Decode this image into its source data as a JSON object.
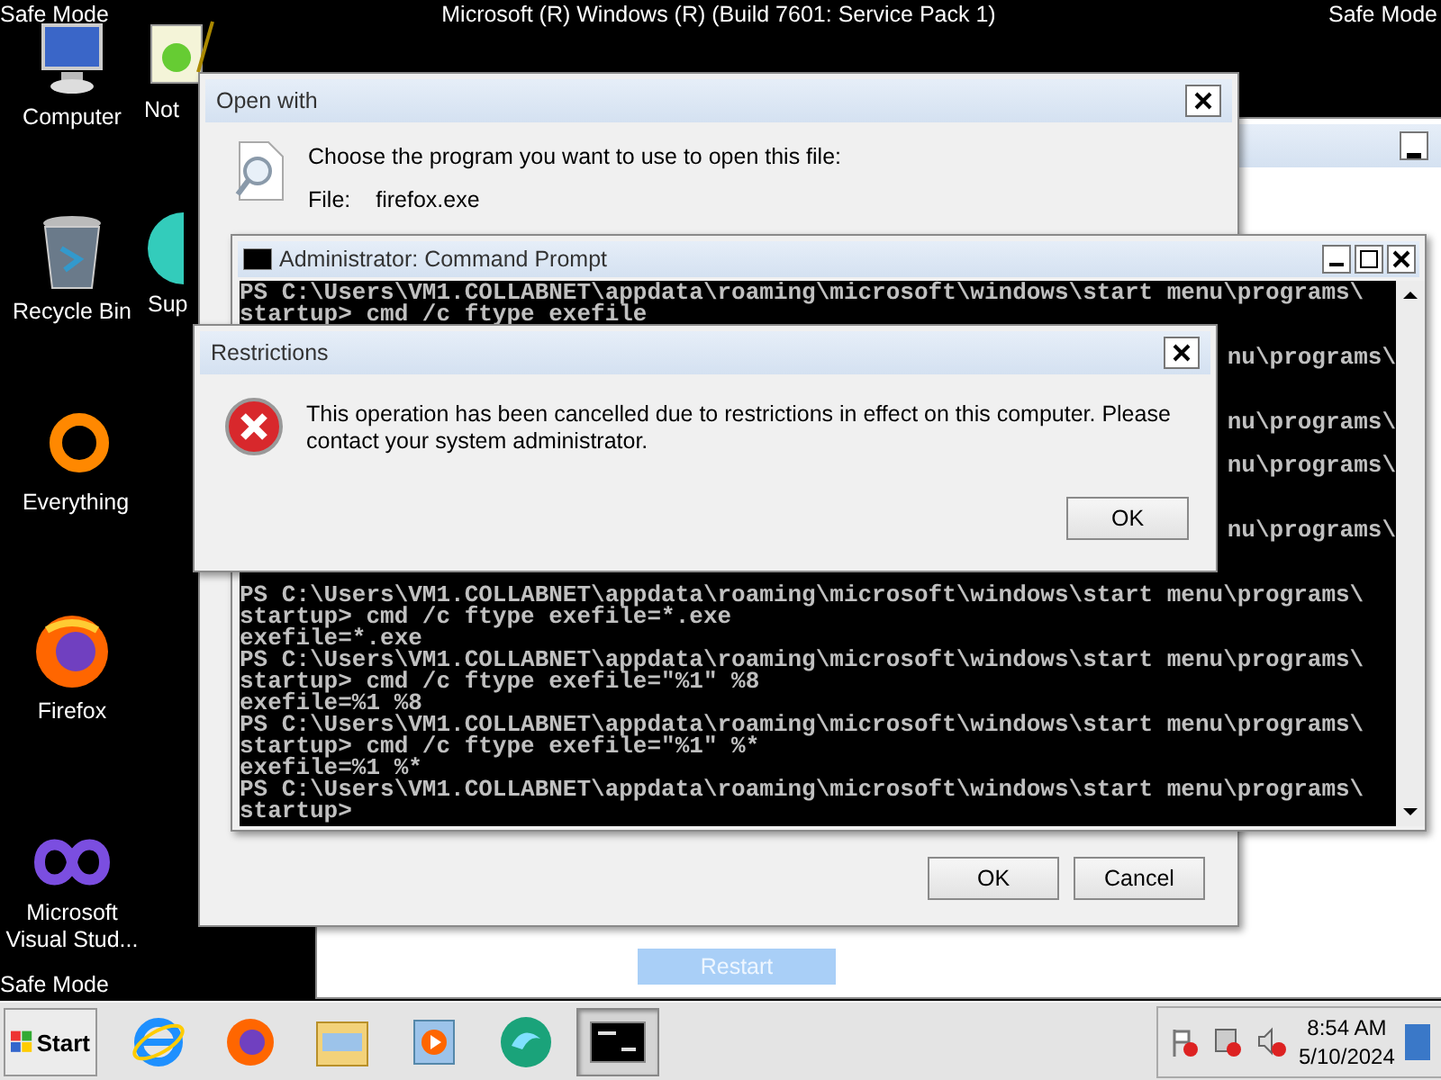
{
  "top_bar": {
    "left": "Safe Mode",
    "title": "Microsoft (R) Windows (R) (Build 7601: Service Pack 1)",
    "right": "Safe Mode"
  },
  "bottom_left_label": "Safe Mode",
  "desktop_icons": [
    {
      "kind": "computer",
      "label": "Computer"
    },
    {
      "kind": "notepad",
      "label": "Not"
    },
    {
      "kind": "recycle",
      "label": "Recycle Bin"
    },
    {
      "kind": "globe",
      "label": "Sup"
    },
    {
      "kind": "ring",
      "label": "Everything"
    },
    {
      "kind": "firefox",
      "label": "Firefox"
    },
    {
      "kind": "infinity",
      "label": "Microsoft Visual Stud..."
    }
  ],
  "background_window": {
    "button": "Restart"
  },
  "open_with": {
    "title": "Open with",
    "prompt": "Choose the program you want to use to open this file:",
    "file_label": "File:",
    "file_name": "firefox.exe",
    "buttons": [
      "OK",
      "Cancel"
    ]
  },
  "command_prompt": {
    "title": "Administrator:  Command Prompt",
    "lines": [
      {
        "kind": "full",
        "text": "PS C:\\Users\\VM1.COLLABNET\\appdata\\roaming\\microsoft\\windows\\start menu\\programs\\"
      },
      {
        "kind": "full",
        "text": "startup> cmd /c ftype exefile"
      },
      {
        "kind": "hidden"
      },
      {
        "kind": "tail",
        "text": "nu\\programs\\"
      },
      {
        "kind": "hidden"
      },
      {
        "kind": "hidden"
      },
      {
        "kind": "tail",
        "text": "nu\\programs\\"
      },
      {
        "kind": "hidden"
      },
      {
        "kind": "tail",
        "text": "nu\\programs\\"
      },
      {
        "kind": "hidden"
      },
      {
        "kind": "hidden"
      },
      {
        "kind": "tail",
        "text": "nu\\programs\\"
      },
      {
        "kind": "hidden"
      },
      {
        "kind": "hidden"
      },
      {
        "kind": "full",
        "text": "PS C:\\Users\\VM1.COLLABNET\\appdata\\roaming\\microsoft\\windows\\start menu\\programs\\"
      },
      {
        "kind": "full",
        "text": "startup> cmd /c ftype exefile=*.exe"
      },
      {
        "kind": "full",
        "text": "exefile=*.exe"
      },
      {
        "kind": "full",
        "text": "PS C:\\Users\\VM1.COLLABNET\\appdata\\roaming\\microsoft\\windows\\start menu\\programs\\"
      },
      {
        "kind": "full",
        "text": "startup> cmd /c ftype exefile=\"%1\" %8"
      },
      {
        "kind": "full",
        "text": "exefile=%1 %8"
      },
      {
        "kind": "full",
        "text": "PS C:\\Users\\VM1.COLLABNET\\appdata\\roaming\\microsoft\\windows\\start menu\\programs\\"
      },
      {
        "kind": "full",
        "text": "startup> cmd /c ftype exefile=\"%1\" %*"
      },
      {
        "kind": "full",
        "text": "exefile=%1 %*"
      },
      {
        "kind": "full",
        "text": "PS C:\\Users\\VM1.COLLABNET\\appdata\\roaming\\microsoft\\windows\\start menu\\programs\\"
      },
      {
        "kind": "full",
        "text": "startup>"
      }
    ]
  },
  "restrictions": {
    "title": "Restrictions",
    "message": "This operation has been cancelled due to restrictions in effect on this computer. Please contact your system administrator.",
    "button": "OK"
  },
  "taskbar": {
    "start": "Start",
    "apps": [
      {
        "kind": "ie",
        "selected": false
      },
      {
        "kind": "firefox",
        "selected": false
      },
      {
        "kind": "folder",
        "selected": false
      },
      {
        "kind": "media",
        "selected": false
      },
      {
        "kind": "edge",
        "selected": false
      },
      {
        "kind": "console",
        "selected": true
      }
    ],
    "tray": [
      {
        "kind": "flag"
      },
      {
        "kind": "network"
      },
      {
        "kind": "volume"
      }
    ],
    "time": "8:54 AM",
    "date": "5/10/2024"
  }
}
